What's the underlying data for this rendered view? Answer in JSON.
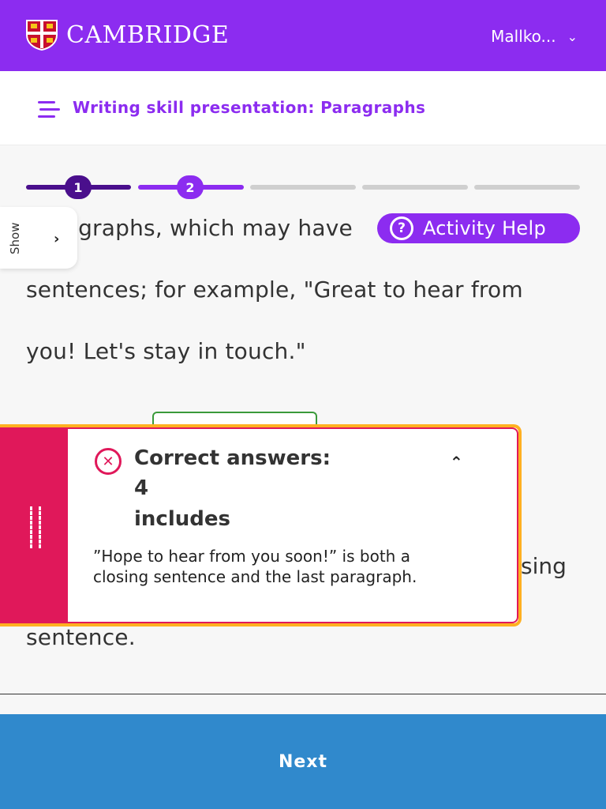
{
  "header": {
    "brand": "CAMBRIDGE",
    "user_name": "Mallko...",
    "brand_color": "#8c2cf0"
  },
  "activity": {
    "title": "Writing skill presentation: Paragraphs"
  },
  "progress": {
    "steps": [
      {
        "label": "1",
        "state": "done",
        "color": "#4a0f8c"
      },
      {
        "label": "2",
        "state": "current",
        "color": "#8c2cf0"
      },
      {
        "label": "",
        "state": "todo"
      },
      {
        "label": "",
        "state": "todo"
      },
      {
        "label": "",
        "state": "todo"
      }
    ]
  },
  "side_tab": {
    "label": "Show"
  },
  "help_button": {
    "label": "Activity Help"
  },
  "content": {
    "lines": [
      "ragraphs, which may have ",
      "sentences; for example, \"Great to hear from",
      "you! Let's stay in touch.\"",
      "sing",
      "sentence."
    ]
  },
  "feedback": {
    "status": "incorrect",
    "title": "Correct answers:",
    "count": "4",
    "kind": "includes",
    "explanation": "”Hope to hear from you soon!” is both a closing sentence and the last paragraph."
  },
  "footer": {
    "next_label": "Next"
  }
}
